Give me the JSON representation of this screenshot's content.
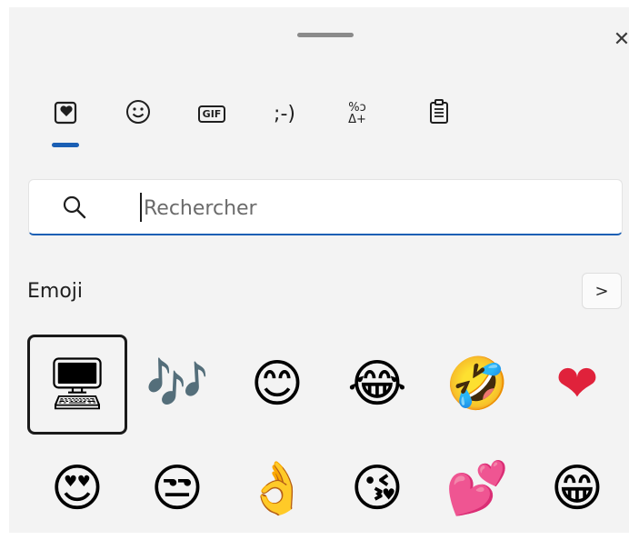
{
  "window": {
    "close_icon": "close-icon"
  },
  "tabs": [
    {
      "name": "emoji-tab",
      "icon": "heart-tile-icon",
      "selected": true
    },
    {
      "name": "kaomoji-smiley-tab",
      "icon": "smiley-icon"
    },
    {
      "name": "gif-tab",
      "label": "GIF",
      "icon": "gif-icon"
    },
    {
      "name": "kaomoji-tab",
      "label": ";-)",
      "icon": "kaomoji-icon"
    },
    {
      "name": "symbols-tab",
      "icon": "symbols-icon"
    },
    {
      "name": "clipboard-tab",
      "icon": "clipboard-icon"
    }
  ],
  "search": {
    "placeholder": "Rechercher",
    "value": ""
  },
  "section": {
    "title": "Emoji",
    "next_label": ">"
  },
  "emojis": [
    {
      "char": "🖥",
      "name": "desktop-computer-emoji",
      "selected": true
    },
    {
      "char": "🎶",
      "name": "musical-notes-emoji"
    },
    {
      "char": "😊",
      "name": "smiling-face-emoji"
    },
    {
      "char": "😂",
      "name": "tears-of-joy-emoji"
    },
    {
      "char": "🤣",
      "name": "rolling-on-floor-laughing-emoji"
    },
    {
      "char": "❤",
      "name": "red-heart-emoji"
    },
    {
      "char": "😍",
      "name": "heart-eyes-emoji"
    },
    {
      "char": "😒",
      "name": "unamused-face-emoji"
    },
    {
      "char": "👌",
      "name": "ok-hand-emoji"
    },
    {
      "char": "😘",
      "name": "blowing-kiss-emoji"
    },
    {
      "char": "💕",
      "name": "two-hearts-emoji"
    },
    {
      "char": "😁",
      "name": "beaming-face-emoji"
    }
  ],
  "colors": {
    "accent": "#1a5fb4",
    "panel": "#f3f3f3"
  }
}
